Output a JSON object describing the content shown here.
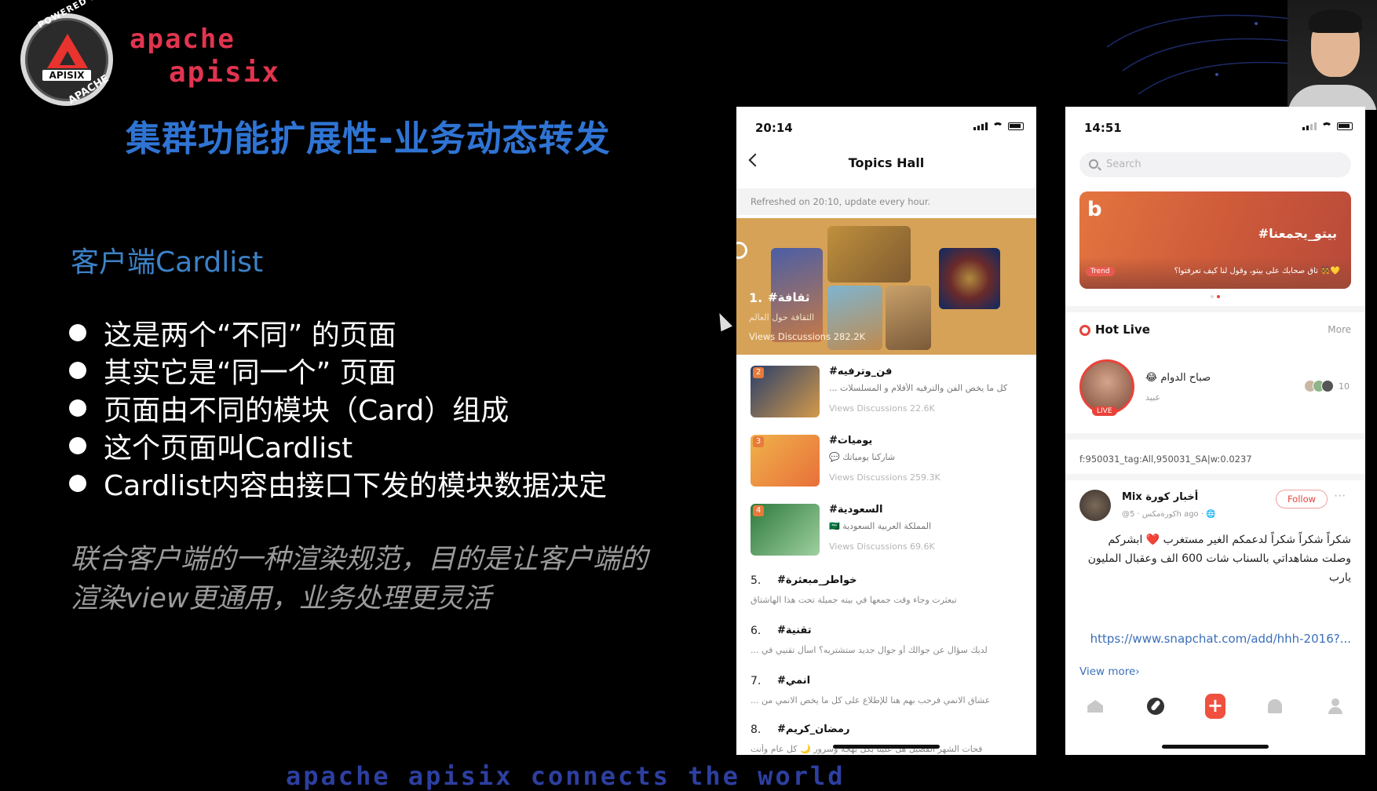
{
  "slide": {
    "logo": {
      "ring_top": "POWERED BY",
      "ring_bottom": "APACHE",
      "center": "APISIX"
    },
    "brand_line1": "apache",
    "brand_line2": "apisix",
    "title": "集群功能扩展性-业务动态转发",
    "section_heading": "客户端Cardlist",
    "bullets": [
      "这是两个“不同” 的页面",
      "其实它是“同一个” 页面",
      "页面由不同的模块（Card）组成",
      "这个页面叫Cardlist",
      "Cardlist内容由接口下发的模块数据决定"
    ],
    "footnote": "联合客户端的一种渲染规范，目的是让客户端的渲染view更通用，业务处理更灵活",
    "bottom_banner": "apache apisix connects the world"
  },
  "phone1": {
    "status_time": "20:14",
    "nav_title": "Topics Hall",
    "refresh_note": "Refreshed on 20:10, update every hour.",
    "hero": {
      "rank": "1.",
      "tag": "#ثقافة",
      "subtitle": "الثقافة حول العالم",
      "stats": "Views   Discussions 282.2K"
    },
    "cards": [
      {
        "rank": "2",
        "tag": "#فن_وترفيه",
        "desc": "كل ما يخص الفن والترفيه الأفلام و المسلسلات ...",
        "stats": "Views   Discussions 22.6K"
      },
      {
        "rank": "3",
        "tag": "#يوميات",
        "desc": "شاركنا يومياتك 💬",
        "stats": "Views   Discussions 259.3K"
      },
      {
        "rank": "4",
        "tag": "#السعودية",
        "desc": "المملكة العربية السعودية 🇸🇦",
        "stats": "Views   Discussions 69.6K"
      }
    ],
    "rows": [
      {
        "num": "5.",
        "tag": "#خواطر_مبعثرة",
        "desc": "تبعثرت وجاء وقت جمعها في بيته جميلة تحت هذا الهاشتاق"
      },
      {
        "num": "6.",
        "tag": "#تقنية",
        "desc": "لديك سؤال عن جوالك أو جوال جديد ستشتريه؟ اسأل تقنيي في ..."
      },
      {
        "num": "7.",
        "tag": "#انمي",
        "desc": "عشاق الانمي فرحب بهم هنا للإطلاع على كل ما يخص الانمي من ..."
      },
      {
        "num": "8.",
        "tag": "#رمضان_كريم",
        "desc": "فحات الشهر الفضيل هل علينا بكل بهجة وسرور 🌙 كل عام وأنت"
      }
    ]
  },
  "phone2": {
    "status_time": "14:51",
    "search_placeholder": "Search",
    "banner": {
      "brand": "b",
      "title": "#بيتو_يجمعنا",
      "trend_badge": "Trend",
      "subtitle": "تاق صحابك على بيتو، وقول لنا كيف تعرفتوا؟ 👯💛"
    },
    "hot_live": {
      "title": "Hot Live",
      "more": "More",
      "live_badge": "LIVE",
      "name": "😂 صباح الدوام",
      "sub": "عبيد",
      "viewer_count": "10"
    },
    "debug_tag": "f:950031_tag:All,950031_SA|w:0.0237",
    "post": {
      "name": "Mix أخبار كورة",
      "meta": "@كورةمكس · 5h ago · 🌐",
      "follow": "Follow",
      "menu": "···",
      "text": "شكراً شكراً شكراً لدعمكم الغير مستغرب ❤️ ابشركم وصلت مشاهداتي بالسناب شات 600 الف وعقبال المليون يارب",
      "link": "https://www.snapchat.com/add/hhh-2016?...",
      "view_more": "View more›"
    }
  }
}
